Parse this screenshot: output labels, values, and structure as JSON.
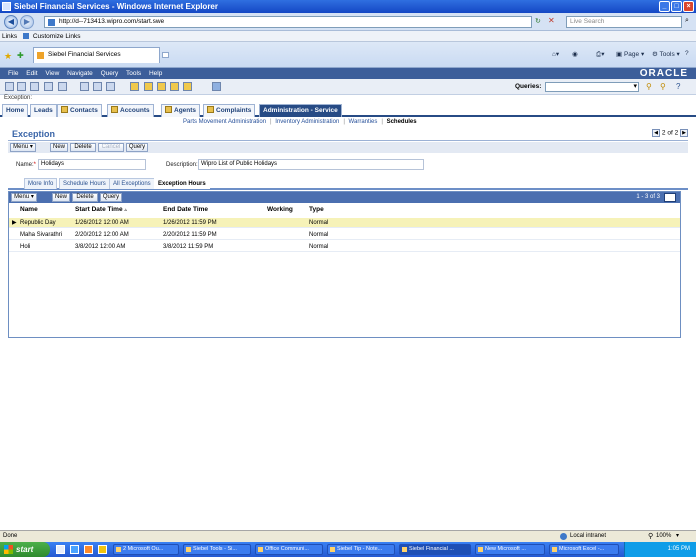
{
  "window": {
    "title": "Siebel Financial Services - Windows Internet Explorer",
    "url": "http://d--713413.wipro.com/start.swe",
    "search_placeholder": "Live Search",
    "links_label": "Links",
    "customize_links": "Customize Links",
    "tab_title": "Siebel Financial Services",
    "cmd_page": "Page",
    "cmd_tools": "Tools"
  },
  "menubar": {
    "items": [
      "File",
      "Edit",
      "View",
      "Navigate",
      "Query",
      "Tools",
      "Help"
    ],
    "brand": "ORACLE"
  },
  "toolbar": {
    "queries_label": "Queries:"
  },
  "screen_label": "Exception:",
  "screen_tabs": [
    "Home",
    "Leads",
    "Contacts",
    "Accounts",
    "Agents",
    "Complaints",
    "Administration - Service"
  ],
  "subnav": {
    "items": [
      "Parts Movement Administration",
      "Inventory Administration",
      "Warranties",
      "Schedules"
    ],
    "current": "Schedules"
  },
  "exception": {
    "title": "Exception",
    "pager": "2 of 2",
    "buttons": {
      "menu": "Menu",
      "new": "New",
      "delete": "Delete",
      "cancel": "Cancel",
      "query": "Query"
    },
    "name_label": "Name:",
    "name_value": "Holidays",
    "description_label": "Description:",
    "description_value": "Wipro List of Public Holidays"
  },
  "view_tabs": [
    "More Info",
    "Schedule Hours",
    "All Exceptions",
    "Exception Hours"
  ],
  "list": {
    "buttons": {
      "menu": "Menu",
      "new": "New",
      "delete": "Delete",
      "query": "Query"
    },
    "count": "1 - 3 of 3",
    "columns": [
      "Name",
      "Start Date Time",
      "End Date Time",
      "Working",
      "Type"
    ],
    "rows": [
      {
        "name": "Republic Day",
        "start": "1/26/2012 12:00 AM",
        "end": "1/26/2012 11:59 PM",
        "working": "",
        "type": "Normal"
      },
      {
        "name": "Maha Sivarathri",
        "start": "2/20/2012 12:00 AM",
        "end": "2/20/2012 11:59 PM",
        "working": "",
        "type": "Normal"
      },
      {
        "name": "Holi",
        "start": "3/8/2012 12:00 AM",
        "end": "3/8/2012 11:59 PM",
        "working": "",
        "type": "Normal"
      }
    ]
  },
  "statusbar": {
    "left": "Done",
    "zone": "Local intranet",
    "zoom": "100%"
  },
  "taskbar": {
    "start": "start",
    "tasks": [
      "2 Microsoft Ou...",
      "Siebel Tools - Si...",
      "Office Communi...",
      "Siebel Tip - Note...",
      "Siebel Financial ...",
      "New Microsoft ...",
      "Microsoft Excel -..."
    ],
    "clock": "1:05 PM"
  }
}
